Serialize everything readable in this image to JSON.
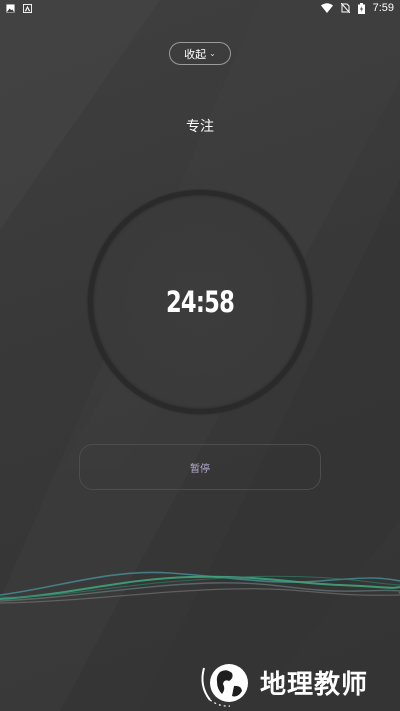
{
  "status_bar": {
    "left_icons": [
      "image-icon",
      "a-letter-icon"
    ],
    "right_icons": [
      "wifi-icon",
      "no-sim-icon",
      "battery-icon"
    ],
    "time": "7:59"
  },
  "header": {
    "collapse_label": "收起",
    "collapse_icon": "chevron-down-icon"
  },
  "focus": {
    "mode_title": "专注",
    "timer": "24:58"
  },
  "controls": {
    "pause_label": "暂停"
  },
  "watermark": {
    "text": "地理教师"
  },
  "colors": {
    "background": "#3a3a3a",
    "pause_text": "#b6acd2",
    "wave_green": "#3fa37a",
    "wave_teal": "#4a8f9a"
  }
}
